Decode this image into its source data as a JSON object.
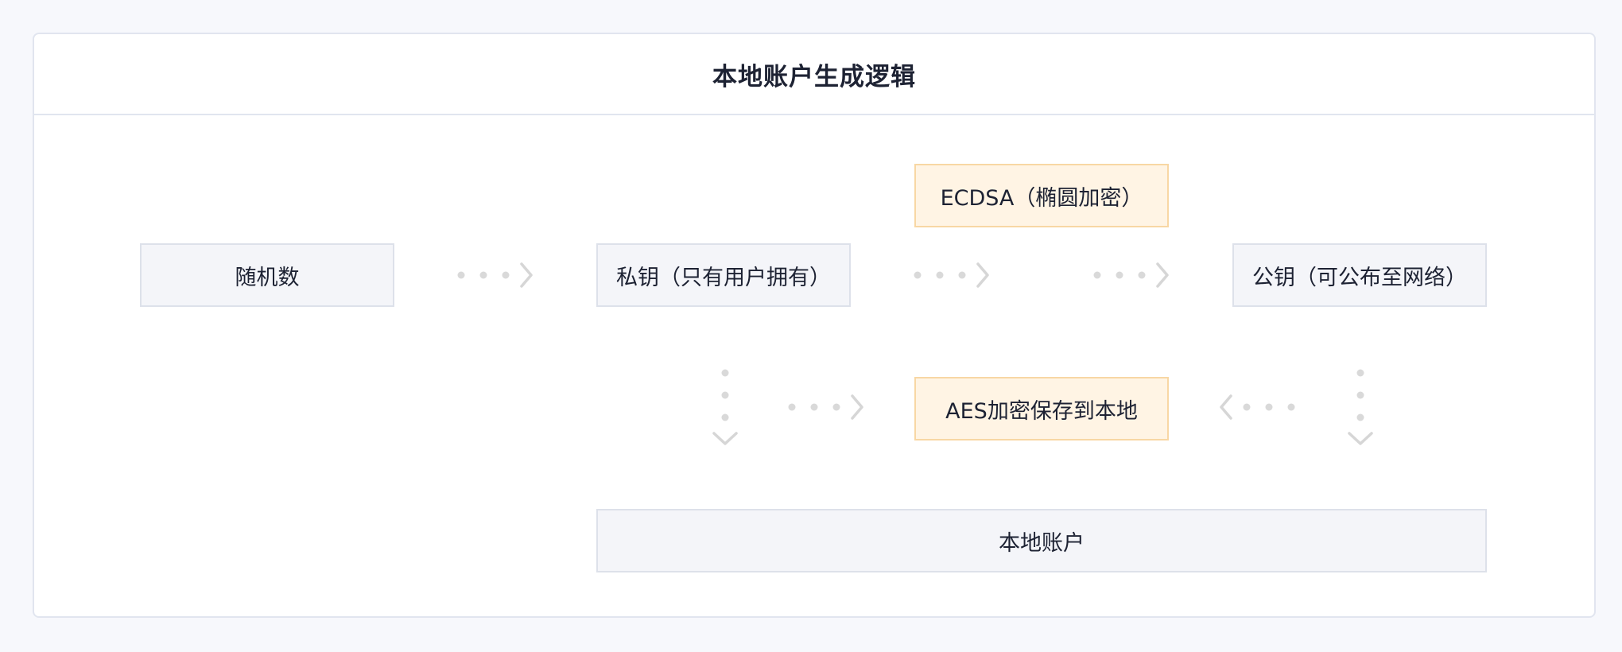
{
  "diagram": {
    "title": "本地账户生成逻辑",
    "nodes": {
      "random": "随机数",
      "private_key": "私钥（只有用户拥有）",
      "ecdsa": "ECDSA（椭圆加密）",
      "public_key": "公钥（可公布至网络）",
      "aes": "AES加密保存到本地",
      "local_account": "本地账户"
    },
    "colors": {
      "page_background": "#f7f8fc",
      "node_grey": "#f4f5f9",
      "node_grey_border": "#dde1ea",
      "node_orange": "#fff4e4",
      "node_orange_border": "#f8d7a4",
      "connector": "#d9d9d9"
    },
    "edges": [
      {
        "from": "random",
        "to": "private_key"
      },
      {
        "from": "private_key",
        "to": "ecdsa"
      },
      {
        "from": "ecdsa",
        "to": "public_key"
      },
      {
        "from": "private_key",
        "to": "aes"
      },
      {
        "from": "public_key",
        "to": "aes"
      },
      {
        "from": "private_key",
        "to": "local_account"
      },
      {
        "from": "public_key",
        "to": "local_account"
      }
    ]
  }
}
